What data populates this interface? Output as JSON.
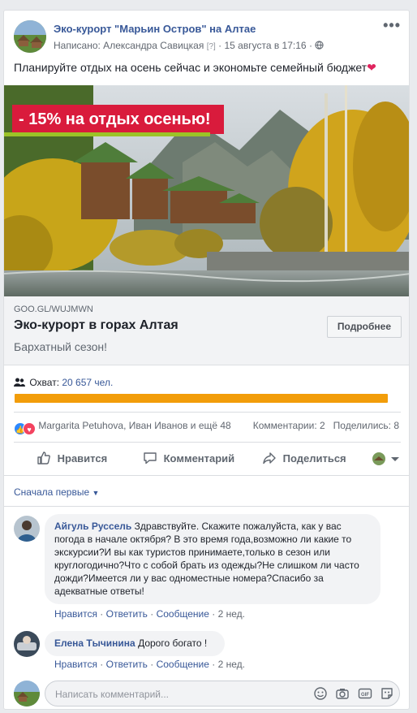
{
  "post": {
    "page_name": "Эко-курорт \"Марьин Остров\" на Алтае",
    "author_line": "Написано: Александра Савицкая",
    "author_hint": "[?]",
    "date": "15 августа в 17:16",
    "text": "Планируйте отдых на осень сейчас и экономьте семейный бюджет",
    "more_icon": "three-dots-icon"
  },
  "image": {
    "banner": "- 15% на отдых осенью!"
  },
  "link": {
    "domain": "GOO.GL/WUJMWN",
    "title": "Эко-курорт в горах Алтая",
    "description": "Бархатный сезон!",
    "button": "Подробнее"
  },
  "reach": {
    "label": "Охват:",
    "value": "20 657 чел.",
    "bar_fraction": 1.0,
    "bar_color": "#f29d0a"
  },
  "reactions": {
    "names": "Margarita Petuhova, Иван Иванов и ещё 48",
    "comments": "Комментарии: 2",
    "shares": "Поделились: 8"
  },
  "actions": {
    "like": "Нравится",
    "comment": "Комментарий",
    "share": "Поделиться"
  },
  "comments_section": {
    "sort_label": "Сначала первые",
    "items": [
      {
        "author": "Айгуль Руссель",
        "text": "Здравствуйте. Скажите пожалуйста, как у вас погода в начале октября? В это время года,возможно ли какие то экскурсии?И вы как туристов принимаете,только в сезон или круглогодично?Что с собой брать из одежды?Не слишком ли часто дожди?Имеется ли у вас одноместные номера?Спасибо за адекватные ответы!",
        "like": "Нравится",
        "reply": "Ответить",
        "message": "Сообщение",
        "time": "2 нед."
      },
      {
        "author": "Елена Тычинина",
        "text": "Дорого богато !",
        "like": "Нравится",
        "reply": "Ответить",
        "message": "Сообщение",
        "time": "2 нед."
      }
    ]
  },
  "composer": {
    "placeholder": "Написать комментарий..."
  },
  "colors": {
    "link_blue": "#385898",
    "banner_red": "#d91b3c",
    "banner_green": "#9cc327",
    "reach_orange": "#f29d0a"
  }
}
